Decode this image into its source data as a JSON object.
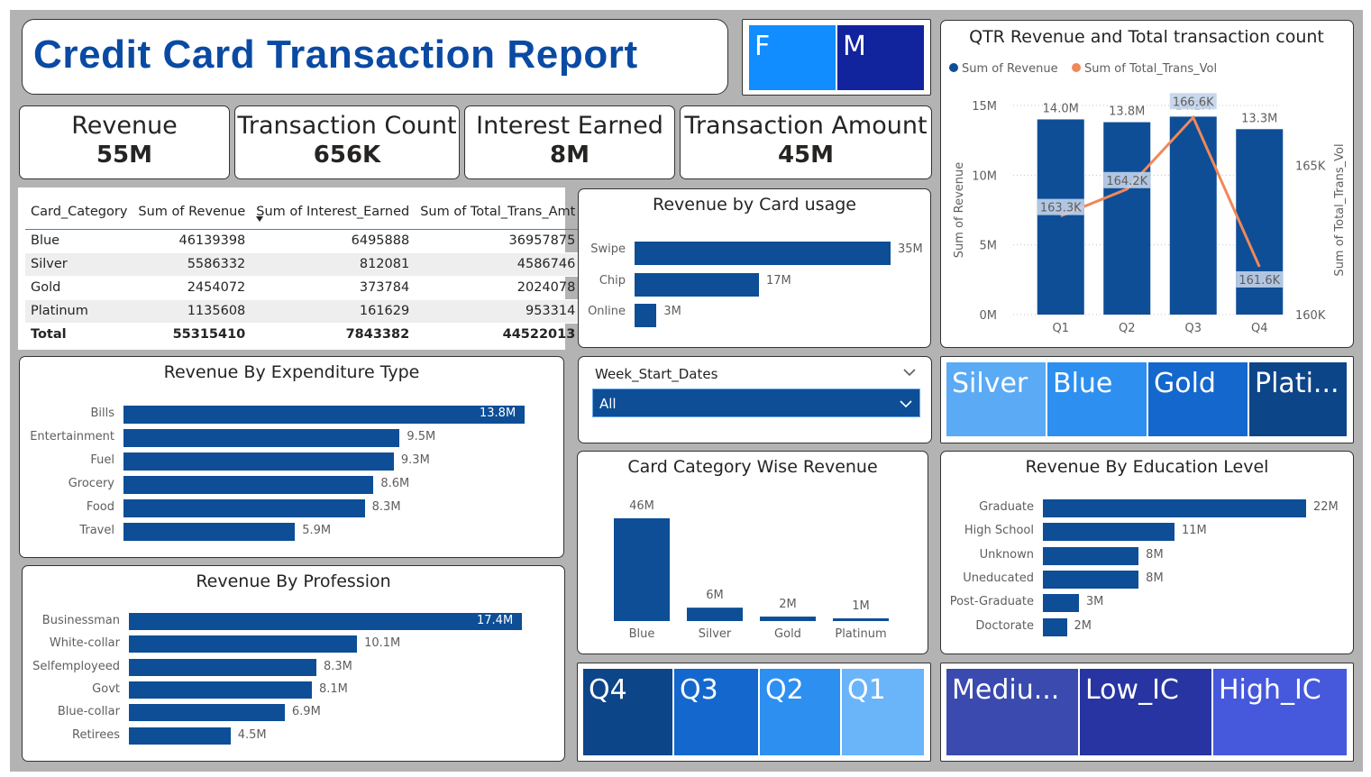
{
  "report_title": "Credit Card Transaction Report",
  "gender_slicer": {
    "items": [
      "F",
      "M"
    ],
    "colors": [
      "#118dff",
      "#12239e"
    ]
  },
  "kpis": [
    {
      "label": "Revenue",
      "value": "55M"
    },
    {
      "label": "Transaction Count",
      "value": "656K"
    },
    {
      "label": "Interest Earned",
      "value": "8M"
    },
    {
      "label": "Transaction Amount",
      "value": "45M"
    }
  ],
  "matrix": {
    "headers": [
      "Card_Category",
      "Sum of Revenue",
      "Sum of Interest_Earned",
      "Sum of Total_Trans_Amt"
    ],
    "rows": [
      [
        "Blue",
        "46139398",
        "6495888",
        "36957875"
      ],
      [
        "Silver",
        "5586332",
        "812081",
        "4586746"
      ],
      [
        "Gold",
        "2454072",
        "373784",
        "2024078"
      ],
      [
        "Platinum",
        "1135608",
        "161629",
        "953314"
      ]
    ],
    "total": [
      "Total",
      "55315410",
      "7843382",
      "44522013"
    ]
  },
  "card_usage": {
    "title": "Revenue by Card usage",
    "categories": [
      "Swipe",
      "Chip",
      "Online"
    ],
    "values": [
      35,
      17,
      3
    ],
    "labels": [
      "35M",
      "17M",
      "3M"
    ]
  },
  "expenditure": {
    "title": "Revenue By Expenditure Type",
    "categories": [
      "Bills",
      "Entertainment",
      "Fuel",
      "Grocery",
      "Food",
      "Travel"
    ],
    "values": [
      13.8,
      9.5,
      9.3,
      8.6,
      8.3,
      5.9
    ],
    "labels": [
      "13.8M",
      "9.5M",
      "9.3M",
      "8.6M",
      "8.3M",
      "5.9M"
    ]
  },
  "profession": {
    "title": "Revenue By Profession",
    "categories": [
      "Businessman",
      "White-collar",
      "Selfemployeed",
      "Govt",
      "Blue-collar",
      "Retirees"
    ],
    "values": [
      17.4,
      10.1,
      8.3,
      8.1,
      6.9,
      4.5
    ],
    "labels": [
      "17.4M",
      "10.1M",
      "8.3M",
      "8.1M",
      "6.9M",
      "4.5M"
    ]
  },
  "week_slicer": {
    "title": "Week_Start_Dates",
    "selected": "All"
  },
  "card_category_slicer": {
    "items": [
      "Silver",
      "Blue",
      "Gold",
      "Plati..."
    ],
    "colors": [
      "#5aaaf5",
      "#2d8ff0",
      "#1467cc",
      "#0d4589"
    ]
  },
  "card_category_revenue": {
    "title": "Card Category Wise Revenue",
    "categories": [
      "Blue",
      "Silver",
      "Gold",
      "Platinum"
    ],
    "values": [
      46,
      6,
      2,
      1
    ],
    "labels": [
      "46M",
      "6M",
      "2M",
      "1M"
    ]
  },
  "education": {
    "title": "Revenue By Education Level",
    "categories": [
      "Graduate",
      "High School",
      "Unknown",
      "Uneducated",
      "Post-Graduate",
      "Doctorate"
    ],
    "values": [
      22,
      11,
      8,
      8,
      3,
      2
    ],
    "labels": [
      "22M",
      "11M",
      "8M",
      "8M",
      "3M",
      "2M"
    ]
  },
  "quarter_slicer": {
    "items": [
      "Q4",
      "Q3",
      "Q2",
      "Q1"
    ],
    "colors": [
      "#0d4589",
      "#1467cc",
      "#2d8ff0",
      "#6ab4fa"
    ]
  },
  "income_slicer": {
    "items": [
      "Mediu...",
      "Low_IC",
      "High_IC"
    ],
    "colors": [
      "#3a4aae",
      "#2734a2",
      "#4658dc"
    ]
  },
  "chart_data": [
    {
      "type": "bar+line",
      "title": "QTR Revenue and Total transaction count",
      "legend": [
        "Sum of Revenue",
        "Sum of Total_Trans_Vol"
      ],
      "legend_position": "top-left",
      "categories": [
        "Q1",
        "Q2",
        "Q3",
        "Q4"
      ],
      "series": [
        {
          "name": "Sum of Revenue",
          "values": [
            14.0,
            13.8,
            14.2,
            13.3
          ],
          "labels": [
            "14.0M",
            "13.8M",
            "14.2M",
            "13.3M"
          ],
          "color": "#0d4e97"
        },
        {
          "name": "Sum of Total_Trans_Vol",
          "values": [
            163.3,
            164.2,
            166.6,
            161.6
          ],
          "labels": [
            "163.3K",
            "164.2K",
            "166.6K",
            "161.6K"
          ],
          "color": "#f0885a"
        }
      ],
      "ylabel": "Sum of Revenue",
      "y2label": "Sum of Total_Trans_Vol",
      "yticks": [
        "0M",
        "5M",
        "10M",
        "15M"
      ],
      "ylim": [
        0,
        15
      ],
      "y2ticks": [
        "160K",
        "165K"
      ],
      "y2lim": [
        160,
        167
      ]
    }
  ]
}
